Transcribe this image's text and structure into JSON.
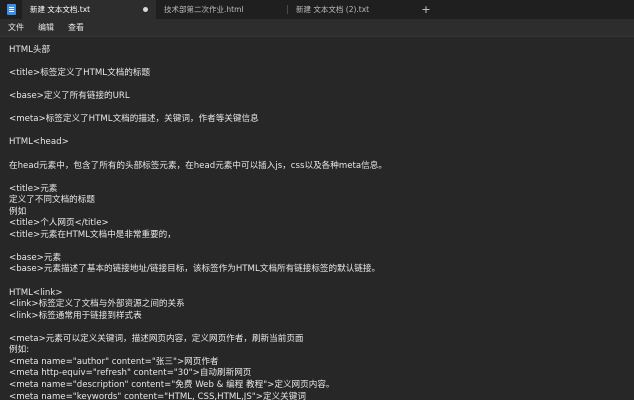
{
  "tabs": [
    {
      "label": "新建 文本文档.txt",
      "active": true,
      "unsaved": true
    },
    {
      "label": "技术部第二次作业.html",
      "active": false,
      "unsaved": false
    },
    {
      "label": "新建 文本文档 (2).txt",
      "active": false,
      "unsaved": false
    }
  ],
  "new_tab_symbol": "+",
  "menu": [
    "文件",
    "编辑",
    "查看"
  ],
  "editor_lines": [
    "HTML头部",
    "",
    "<title>标签定义了HTML文档的标题",
    "",
    "<base>定义了所有链接的URL",
    "",
    "<meta>标签定义了HTML文档的描述，关键词，作者等关键信息",
    "",
    "HTML<head>",
    "",
    "在head元素中，包含了所有的头部标签元素，在head元素中可以插入js，css以及各种meta信息。",
    "",
    "<title>元素",
    "定义了不同文档的标题",
    "例如",
    "<title>个人网页</title>",
    "<title>元素在HTML文档中是非常重要的，",
    "",
    "<base>元素",
    "<base>元素描述了基本的链接地址/链接目标，该标签作为HTML文档所有链接标签的默认链接。",
    "",
    "HTML<link>",
    "<link>标签定义了文档与外部资源之间的关系",
    "<link>标签通常用于链接到样式表",
    "",
    "<meta>元素可以定义关键词，描述网页内容，定义网页作者，刷新当前页面",
    "例如:",
    "<meta name=\"author\" content=\"张三\">网页作者",
    "<meta http-equiv=\"refresh\" content=\"30\">自动刷新网页",
    "<meta name=\"description\" content=\"免费 Web & 编程 教程\">定义网页内容。",
    "<meta name=\"keywords\" content=\"HTML, CSS,HTML,JS\">定义关键词"
  ]
}
